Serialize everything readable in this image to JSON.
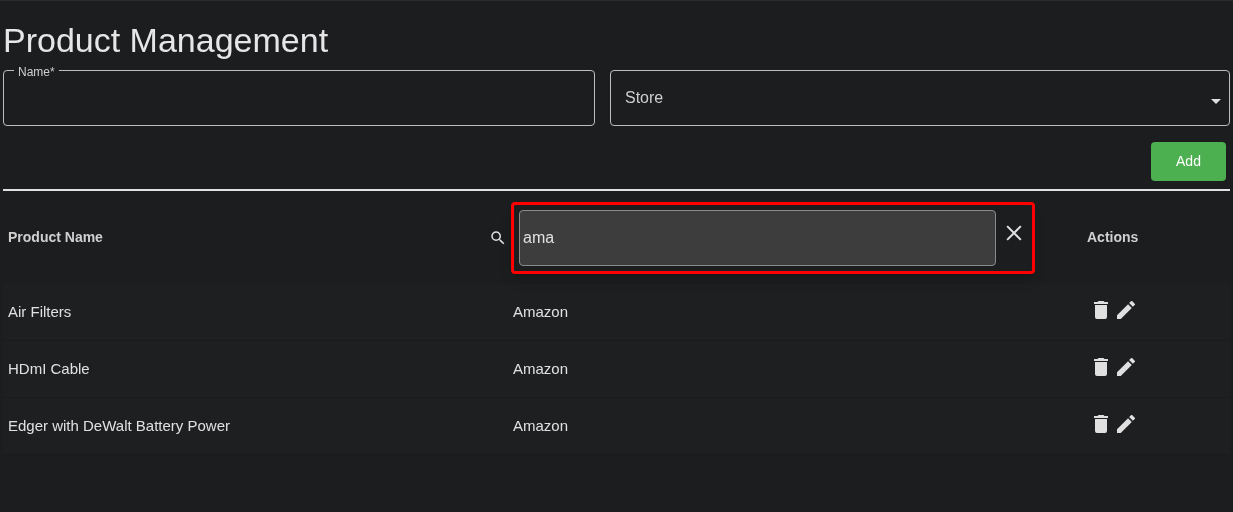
{
  "title": "Product Management",
  "form": {
    "name_field": {
      "label": "Name*"
    },
    "store_select": {
      "placeholder": "Store"
    },
    "add_button": "Add"
  },
  "table": {
    "columns": [
      {
        "label": "Product Name"
      },
      {
        "label": "Actions"
      }
    ],
    "filter": {
      "value": "ama"
    },
    "rows": [
      {
        "product": "Air Filters",
        "store": "Amazon"
      },
      {
        "product": "HDmI Cable",
        "store": "Amazon"
      },
      {
        "product": "Edger with DeWalt Battery Power",
        "store": "Amazon"
      }
    ]
  }
}
